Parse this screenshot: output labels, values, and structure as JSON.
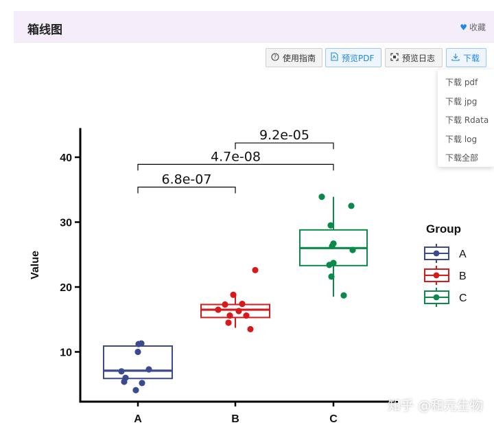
{
  "header": {
    "title": "箱线图",
    "fav_label": "收藏"
  },
  "toolbar": {
    "guide": "使用指南",
    "preview_pdf": "预览PDF",
    "preview_log": "预览日志",
    "download": "下载"
  },
  "download_menu": [
    "下载 pdf",
    "下载 jpg",
    "下载 Rdata",
    "下载 log",
    "下载全部"
  ],
  "watermark": "知乎 @和元生物",
  "colors": {
    "A": "#3b4a8c",
    "B": "#d7191c",
    "C": "#0a8a4a",
    "accent": "#1e88e5"
  },
  "chart_data": {
    "type": "box",
    "categories": [
      "A",
      "B",
      "C"
    ],
    "xlabel": "",
    "ylabel": "Value",
    "yticks": [
      10,
      20,
      30,
      40
    ],
    "ylim": [
      2,
      44.5
    ],
    "legend": {
      "title": "Group",
      "entries": [
        "A",
        "B",
        "C"
      ],
      "position": "right"
    },
    "series": [
      {
        "name": "A",
        "q1": 5.9,
        "median": 7.1,
        "q3": 10.9,
        "min": 5.9,
        "max": 10.9,
        "points": [
          11.3,
          11.2,
          10.0,
          7.3,
          7.0,
          6.0,
          5.4,
          5.2,
          4.1
        ]
      },
      {
        "name": "B",
        "q1": 15.3,
        "median": 16.5,
        "q3": 17.3,
        "min": 13.7,
        "max": 18.8,
        "points": [
          22.6,
          18.8,
          17.4,
          17.3,
          16.5,
          16.3,
          15.6,
          15.6,
          14.5,
          13.5
        ]
      },
      {
        "name": "C",
        "q1": 23.3,
        "median": 26.0,
        "q3": 28.8,
        "min": 18.5,
        "max": 33.9,
        "points": [
          33.9,
          32.5,
          29.5,
          26.7,
          26.3,
          25.7,
          23.7,
          23.4,
          21.6,
          18.7
        ]
      }
    ],
    "comparisons": [
      {
        "from": "A",
        "to": "B",
        "label": "6.8e-07",
        "y": 35.4
      },
      {
        "from": "A",
        "to": "C",
        "label": "4.7e-08",
        "y": 38.9
      },
      {
        "from": "B",
        "to": "C",
        "label": "9.2e-05",
        "y": 42.2
      }
    ]
  }
}
